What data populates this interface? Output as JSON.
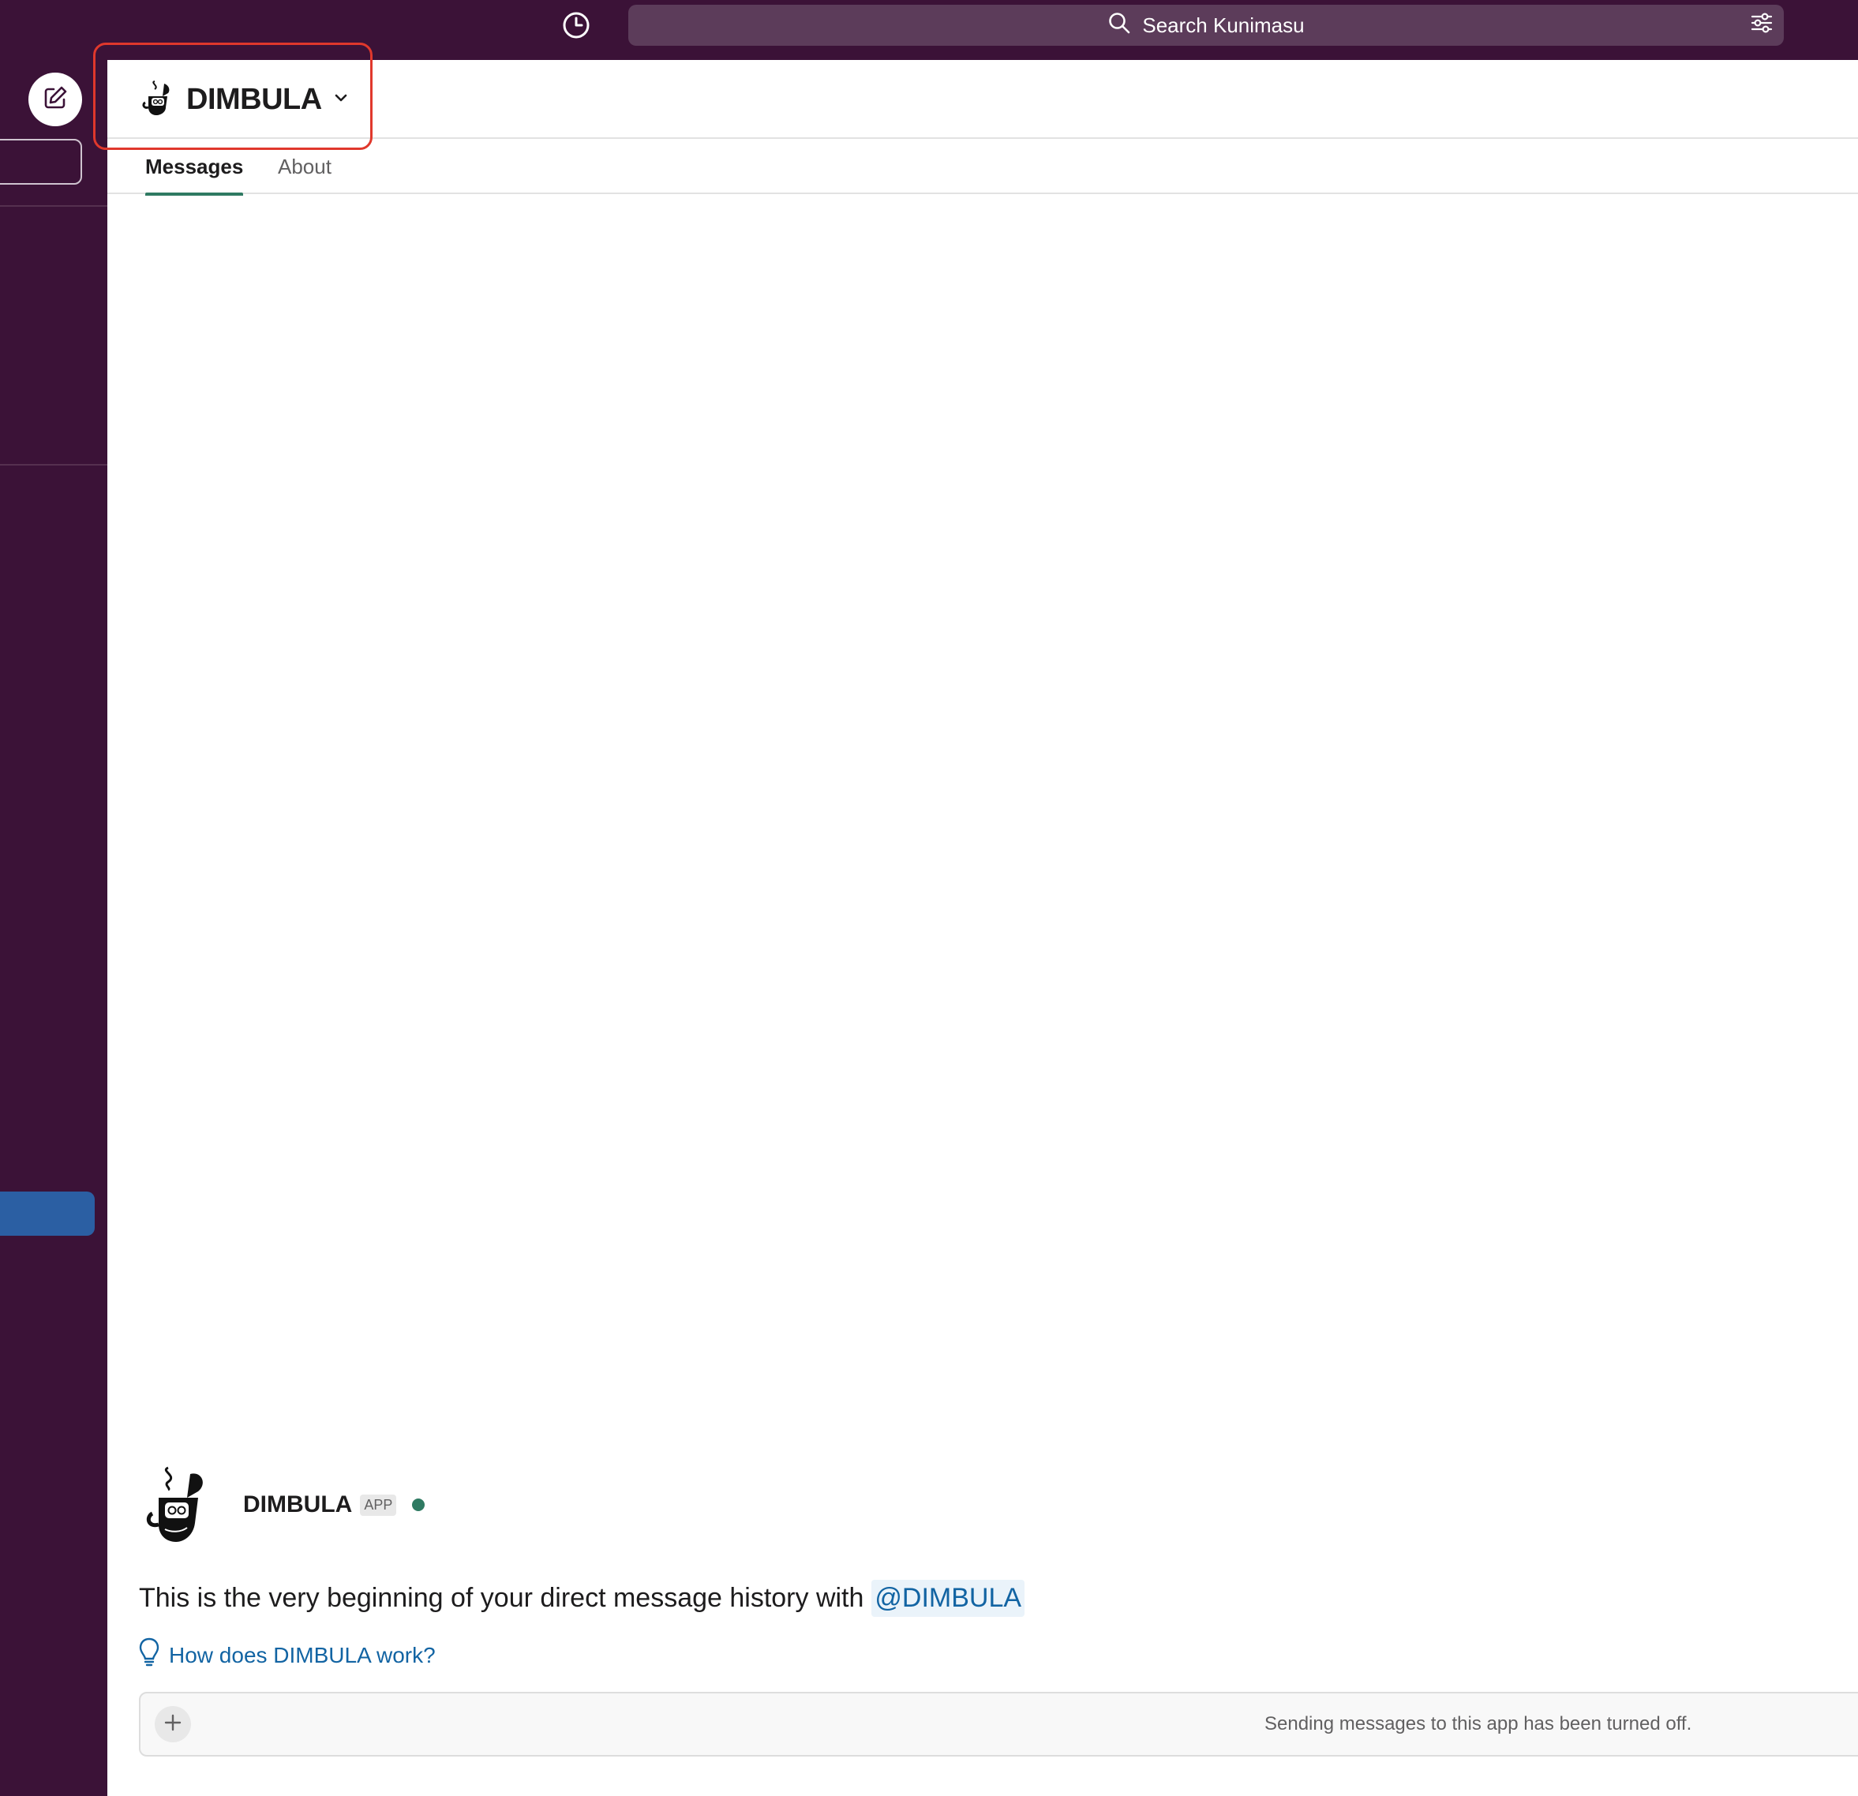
{
  "topbar": {
    "search_placeholder": "Search Kunimasu",
    "icons": [
      "history-icon",
      "search-icon",
      "filter-icon"
    ]
  },
  "sidebar": {
    "icons": [
      "compose-icon"
    ]
  },
  "channel": {
    "name": "DIMBULA",
    "icons": [
      "bot-avatar-icon",
      "chevron-down-icon"
    ]
  },
  "tabs": [
    {
      "label": "Messages",
      "active": true
    },
    {
      "label": "About",
      "active": false
    }
  ],
  "intro": {
    "bot_name": "DIMBULA",
    "badge": "APP",
    "text": "This is the very beginning of your direct message history with",
    "mention": "@DIMBULA",
    "help_link": "How does DIMBULA work?",
    "status_color": "#2f7a62"
  },
  "composer": {
    "note": "Sending messages to this app has been turned off."
  },
  "colors": {
    "sidebar_bg": "#3b1237",
    "search_bg": "#5c3c5a",
    "selected_item": "#2b5fa3",
    "link": "#1264a3",
    "highlight": "#e0382c"
  }
}
